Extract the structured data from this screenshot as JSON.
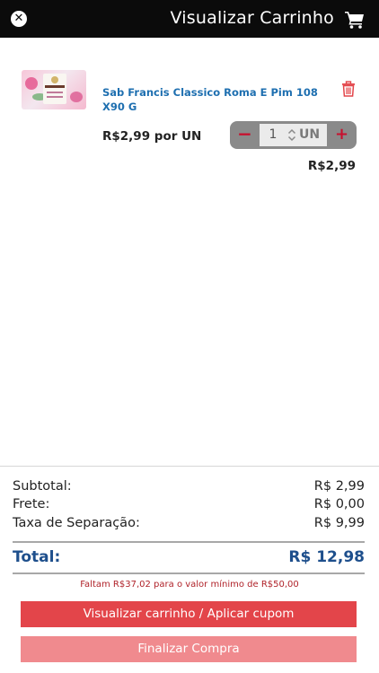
{
  "header": {
    "title": "Visualizar Carrinho",
    "close_glyph": "✕",
    "close_icon": "close-circle-icon",
    "cart_icon": "shopping-cart-icon"
  },
  "cart_item": {
    "name_line1": "Sab Francis Classico Roma E Pim 108",
    "name_line2": "X90 G",
    "unit_price": "R$2,99 por UN",
    "quantity": "1",
    "unit": "UN",
    "minus_glyph": "−",
    "plus_glyph": "+",
    "line_total": "R$2,99",
    "delete_icon": "trash-icon"
  },
  "summary": {
    "subtotal_label": "Subtotal:",
    "subtotal_value": "R$ 2,99",
    "shipping_label": "Frete:",
    "shipping_value": "R$ 0,00",
    "separation_label": "Taxa de Separação:",
    "separation_value": "R$ 9,99",
    "total_label": "Total:",
    "total_value": "R$ 12,98",
    "minimum_note": "Faltam R$37,02 para o valor mínimo de R$50,00"
  },
  "buttons": {
    "view_cart": "Visualizar carrinho / Aplicar cupom",
    "finalize": "Finalizar Compra"
  },
  "colors": {
    "header_bg": "#0b0b0b",
    "product_name": "#1e6fb0",
    "total_text": "#1e4f8c",
    "accent_red": "#c8102e",
    "button_primary": "#e3454a",
    "button_secondary": "#f08a8e"
  }
}
